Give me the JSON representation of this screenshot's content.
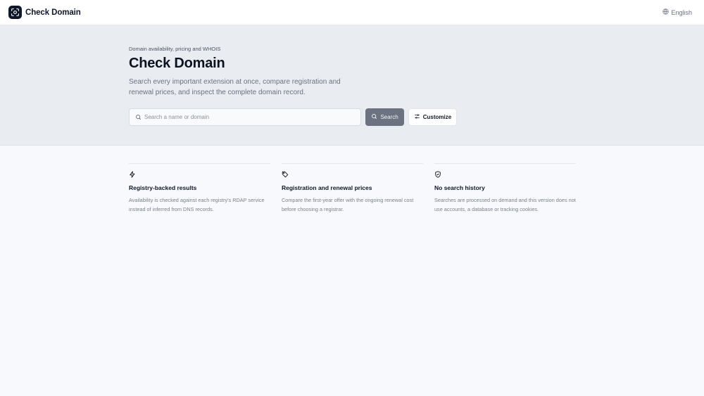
{
  "header": {
    "brand_name": "Check Domain",
    "language_label": "English"
  },
  "hero": {
    "eyebrow": "Domain availability, pricing and WHOIS",
    "title": "Check Domain",
    "subtitle": "Search every important extension at once, compare registration and renewal prices, and inspect the complete domain record.",
    "search_placeholder": "Search a name or domain",
    "search_value": "",
    "search_button_label": "Search",
    "customize_button_label": "Customize"
  },
  "features": [
    {
      "icon": "lightning-icon",
      "title": "Registry-backed results",
      "description": "Availability is checked against each registry's RDAP service instead of inferred from DNS records."
    },
    {
      "icon": "price-tag-icon",
      "title": "Registration and renewal prices",
      "description": "Compare the first-year offer with the ongoing renewal cost before choosing a registrar."
    },
    {
      "icon": "shield-check-icon",
      "title": "No search history",
      "description": "Searches are processed on demand and this version does not use accounts, a database or tracking cookies."
    }
  ],
  "colors": {
    "hero_background": "#e9ecf1",
    "page_background": "#f8f9fc",
    "search_button": "#6b7280",
    "logo_background": "#111827"
  }
}
